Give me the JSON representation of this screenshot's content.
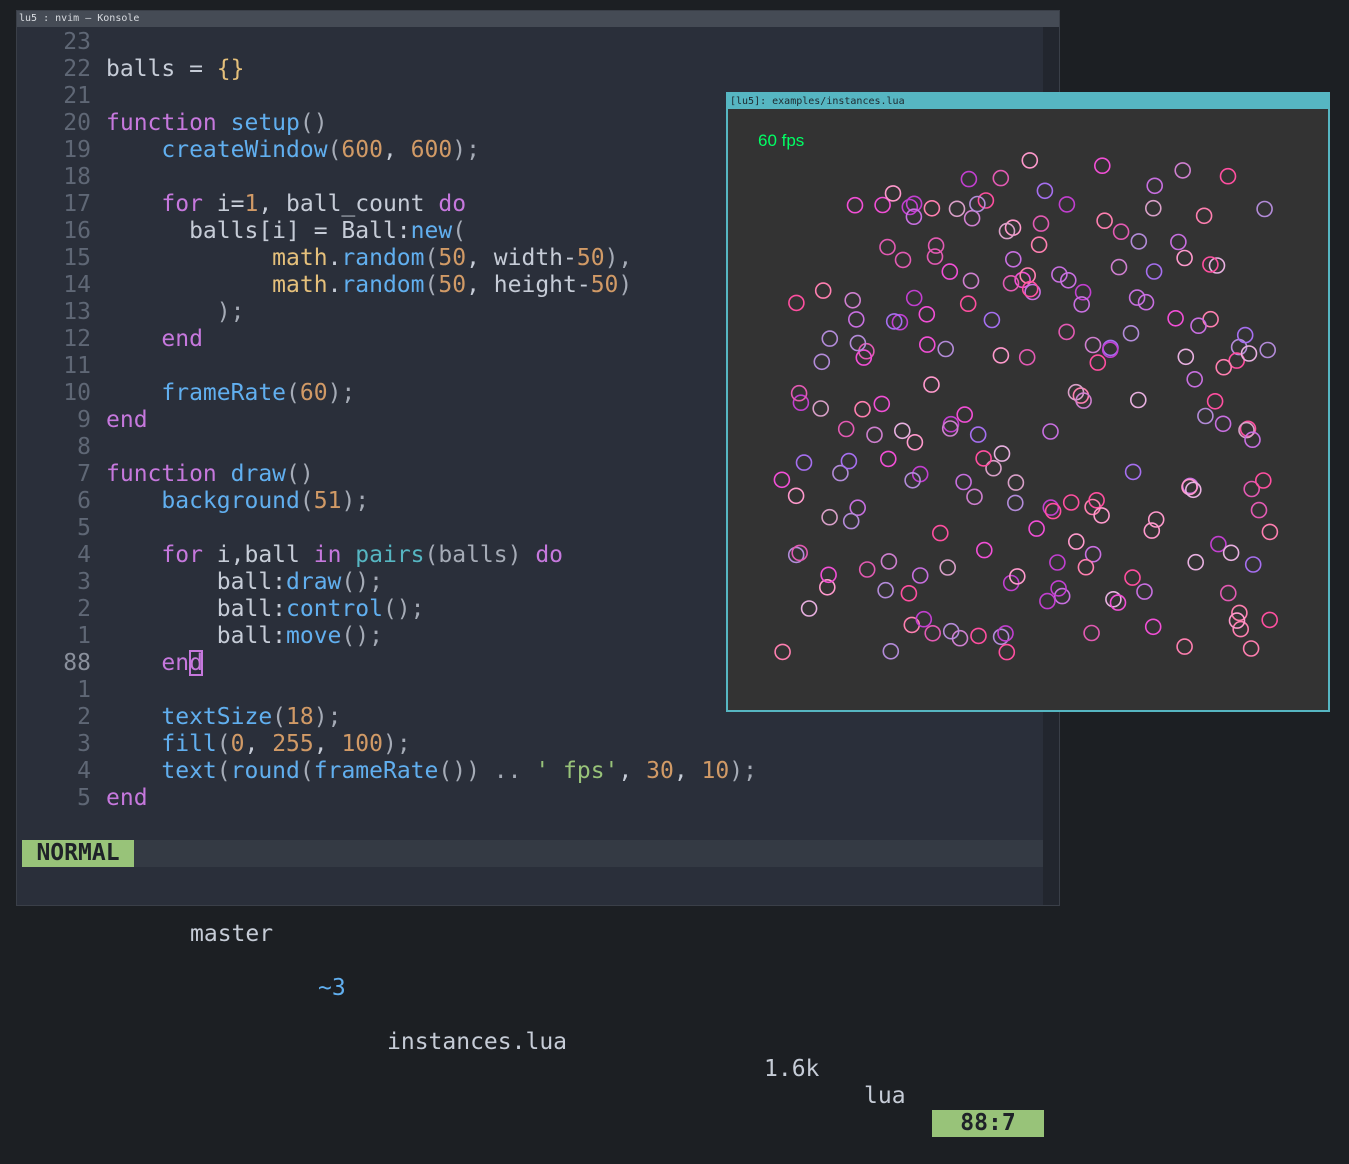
{
  "konsole": {
    "title": "lu5 : nvim — Konsole"
  },
  "editor": {
    "lines": [
      {
        "ln": "23",
        "tokens": []
      },
      {
        "ln": "22",
        "tokens": [
          [
            "balls = ",
            "#c6ccd7"
          ],
          [
            "{}",
            "#e5c07b"
          ]
        ]
      },
      {
        "ln": "21",
        "tokens": []
      },
      {
        "ln": "20",
        "tokens": [
          [
            "function",
            "#c678dd"
          ],
          [
            " ",
            "#c6ccd7"
          ],
          [
            "setup",
            "#61afef"
          ],
          [
            "()",
            "#a5abb6"
          ]
        ]
      },
      {
        "ln": "19",
        "tokens": [
          [
            "    ",
            "#c6ccd7"
          ],
          [
            "createWindow",
            "#61afef"
          ],
          [
            "(",
            "#a5abb6"
          ],
          [
            "600",
            "#d19a66"
          ],
          [
            ", ",
            "#c6ccd7"
          ],
          [
            "600",
            "#d19a66"
          ],
          [
            ");",
            "#a5abb6"
          ]
        ]
      },
      {
        "ln": "18",
        "tokens": []
      },
      {
        "ln": "17",
        "tokens": [
          [
            "    ",
            "#c6ccd7"
          ],
          [
            "for",
            "#c678dd"
          ],
          [
            " i=",
            "#c6ccd7"
          ],
          [
            "1",
            "#d19a66"
          ],
          [
            ", ball_count ",
            "#c6ccd7"
          ],
          [
            "do",
            "#c678dd"
          ]
        ]
      },
      {
        "ln": "16",
        "tokens": [
          [
            "      balls[i] = Ball:",
            "#c6ccd7"
          ],
          [
            "new",
            "#61afef"
          ],
          [
            "(",
            "#a5abb6"
          ]
        ]
      },
      {
        "ln": "15",
        "tokens": [
          [
            "            ",
            "#c6ccd7"
          ],
          [
            "math",
            "#e5c07b"
          ],
          [
            ".",
            "#c6ccd7"
          ],
          [
            "random",
            "#61afef"
          ],
          [
            "(",
            "#a5abb6"
          ],
          [
            "50",
            "#d19a66"
          ],
          [
            ", width-",
            "#c6ccd7"
          ],
          [
            "50",
            "#d19a66"
          ],
          [
            "),",
            "#a5abb6"
          ]
        ]
      },
      {
        "ln": "14",
        "tokens": [
          [
            "            ",
            "#c6ccd7"
          ],
          [
            "math",
            "#e5c07b"
          ],
          [
            ".",
            "#c6ccd7"
          ],
          [
            "random",
            "#61afef"
          ],
          [
            "(",
            "#a5abb6"
          ],
          [
            "50",
            "#d19a66"
          ],
          [
            ", height-",
            "#c6ccd7"
          ],
          [
            "50",
            "#d19a66"
          ],
          [
            ")",
            "#a5abb6"
          ]
        ]
      },
      {
        "ln": "13",
        "tokens": [
          [
            "        );",
            "#a5abb6"
          ]
        ]
      },
      {
        "ln": "12",
        "tokens": [
          [
            "    ",
            "#c6ccd7"
          ],
          [
            "end",
            "#c678dd"
          ]
        ]
      },
      {
        "ln": "11",
        "tokens": []
      },
      {
        "ln": "10",
        "tokens": [
          [
            "    ",
            "#c6ccd7"
          ],
          [
            "frameRate",
            "#61afef"
          ],
          [
            "(",
            "#a5abb6"
          ],
          [
            "60",
            "#d19a66"
          ],
          [
            ");",
            "#a5abb6"
          ]
        ]
      },
      {
        "ln": "9",
        "tokens": [
          [
            "end",
            "#c678dd"
          ]
        ]
      },
      {
        "ln": "8",
        "tokens": []
      },
      {
        "ln": "7",
        "tokens": [
          [
            "function",
            "#c678dd"
          ],
          [
            " ",
            "#c6ccd7"
          ],
          [
            "draw",
            "#61afef"
          ],
          [
            "()",
            "#a5abb6"
          ]
        ]
      },
      {
        "ln": "6",
        "tokens": [
          [
            "    ",
            "#c6ccd7"
          ],
          [
            "background",
            "#61afef"
          ],
          [
            "(",
            "#a5abb6"
          ],
          [
            "51",
            "#d19a66"
          ],
          [
            ");",
            "#a5abb6"
          ]
        ]
      },
      {
        "ln": "5",
        "tokens": []
      },
      {
        "ln": "4",
        "tokens": [
          [
            "    ",
            "#c6ccd7"
          ],
          [
            "for",
            "#c678dd"
          ],
          [
            " i,ball ",
            "#c6ccd7"
          ],
          [
            "in",
            "#c678dd"
          ],
          [
            " ",
            "#c6ccd7"
          ],
          [
            "pairs",
            "#56b6c2"
          ],
          [
            "(balls) ",
            "#a5abb6"
          ],
          [
            "do",
            "#c678dd"
          ]
        ]
      },
      {
        "ln": "3",
        "tokens": [
          [
            "        ball:",
            "#c6ccd7"
          ],
          [
            "draw",
            "#61afef"
          ],
          [
            "();",
            "#a5abb6"
          ]
        ]
      },
      {
        "ln": "2",
        "tokens": [
          [
            "        ball:",
            "#c6ccd7"
          ],
          [
            "control",
            "#61afef"
          ],
          [
            "();",
            "#a5abb6"
          ]
        ]
      },
      {
        "ln": "1",
        "tokens": [
          [
            "        ball:",
            "#c6ccd7"
          ],
          [
            "move",
            "#61afef"
          ],
          [
            "();",
            "#a5abb6"
          ]
        ]
      },
      {
        "ln": "88",
        "current": true,
        "tokens": [
          [
            "    ",
            "#c6ccd7"
          ],
          [
            "en",
            "#c678dd"
          ],
          [
            "d",
            "#c678dd",
            "cursor"
          ]
        ]
      },
      {
        "ln": "1",
        "tokens": []
      },
      {
        "ln": "2",
        "tokens": [
          [
            "    ",
            "#c6ccd7"
          ],
          [
            "textSize",
            "#61afef"
          ],
          [
            "(",
            "#a5abb6"
          ],
          [
            "18",
            "#d19a66"
          ],
          [
            ");",
            "#a5abb6"
          ]
        ]
      },
      {
        "ln": "3",
        "tokens": [
          [
            "    ",
            "#c6ccd7"
          ],
          [
            "fill",
            "#61afef"
          ],
          [
            "(",
            "#a5abb6"
          ],
          [
            "0",
            "#d19a66"
          ],
          [
            ", ",
            "#c6ccd7"
          ],
          [
            "255",
            "#d19a66"
          ],
          [
            ", ",
            "#c6ccd7"
          ],
          [
            "100",
            "#d19a66"
          ],
          [
            ");",
            "#a5abb6"
          ]
        ]
      },
      {
        "ln": "4",
        "tokens": [
          [
            "    ",
            "#c6ccd7"
          ],
          [
            "text",
            "#61afef"
          ],
          [
            "(",
            "#a5abb6"
          ],
          [
            "round",
            "#61afef"
          ],
          [
            "(",
            "#a5abb6"
          ],
          [
            "frameRate",
            "#61afef"
          ],
          [
            "()) .. ",
            "#a5abb6"
          ],
          [
            "' fps'",
            "#98c379"
          ],
          [
            ", ",
            "#c6ccd7"
          ],
          [
            "30",
            "#d19a66"
          ],
          [
            ", ",
            "#c6ccd7"
          ],
          [
            "10",
            "#d19a66"
          ],
          [
            ");",
            "#a5abb6"
          ]
        ]
      },
      {
        "ln": "5",
        "tokens": [
          [
            "end",
            "#c678dd"
          ]
        ]
      }
    ]
  },
  "statusline": {
    "mode": "NORMAL",
    "branch_icon": "",
    "branch": "master",
    "git_icon": "",
    "changes": "~3",
    "sep": "",
    "file": "instances.lua",
    "size": "1.6k",
    "lang": "lua",
    "position": "88:7"
  },
  "lu5": {
    "title": "[lu5]: examples/instances.lua",
    "fps_text": "60 fps",
    "fps_color": "#00ff64",
    "background": "#333333",
    "canvas_size": [
      600,
      600
    ],
    "ball_colors": [
      "#f24fd6",
      "#c86fe0",
      "#e35ab3",
      "#ff7fb0",
      "#b38bd9",
      "#d9a0c8",
      "#ff4fa0",
      "#a66ff0",
      "#cf7fcf",
      "#e8b0e0",
      "#c23fd0",
      "#ff99cc"
    ],
    "ball_count": 200
  }
}
